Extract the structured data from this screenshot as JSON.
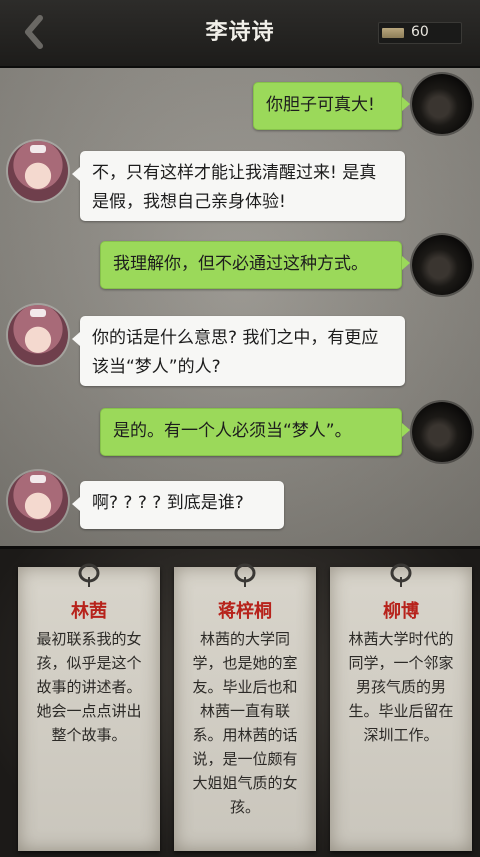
{
  "header": {
    "title": "李诗诗",
    "counter": "60"
  },
  "messages": [
    {
      "side": "right",
      "text": "你胆子可真大!"
    },
    {
      "side": "left",
      "text": "不，只有这样才能让我清醒过来! 是真是假，我想自己亲身体验!"
    },
    {
      "side": "right",
      "text": "我理解你，但不必通过这种方式。"
    },
    {
      "side": "left",
      "text": "你的话是什么意思? 我们之中，有更应该当“梦人”的人?"
    },
    {
      "side": "right",
      "text": "是的。有一个人必须当“梦人”。"
    },
    {
      "side": "left",
      "text": "啊? ? ? ? 到底是谁?"
    }
  ],
  "cards": [
    {
      "name": "林茜",
      "desc": "最初联系我的女孩，似乎是这个故事的讲述者。她会一点点讲出整个故事。"
    },
    {
      "name": "蒋梓桐",
      "desc": "林茜的大学同学，也是她的室友。毕业后也和林茜一直有联系。用林茜的话说，是一位颇有大姐姐气质的女孩。"
    },
    {
      "name": "柳博",
      "desc": "林茜大学时代的同学，一个邻家男孩气质的男生。毕业后留在深圳工作。"
    }
  ],
  "colors": {
    "green_bubble": "#9bd95a",
    "card_name": "#b7221b"
  }
}
